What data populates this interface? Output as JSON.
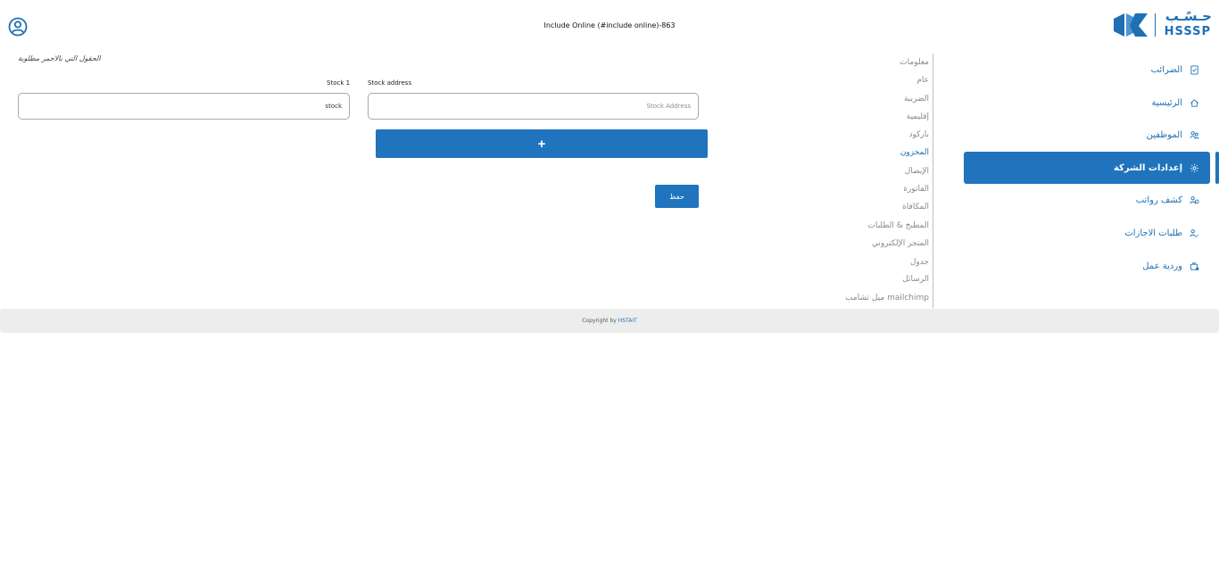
{
  "header": {
    "title": "Include Online (#include online)-863",
    "logo_ar": "حـسًـب",
    "logo_en": "HSSSP",
    "user_icon": "user-circle-icon"
  },
  "sidebar": {
    "items": [
      {
        "label": "الضرائب",
        "icon": "tax-document-icon",
        "active": false
      },
      {
        "label": "الرئيسية",
        "icon": "home-icon",
        "active": false
      },
      {
        "label": "الموظفين",
        "icon": "users-icon",
        "active": false
      },
      {
        "label": "إعدادات الشركة",
        "icon": "gear-icon",
        "active": true
      },
      {
        "label": "كشف رواتب",
        "icon": "payroll-icon",
        "active": false
      },
      {
        "label": "طلبات الاجازات",
        "icon": "leave-request-icon",
        "active": false
      },
      {
        "label": "وردية عمل",
        "icon": "shift-briefcase-icon",
        "active": false
      }
    ],
    "accent": "#1f74bd"
  },
  "subnav": {
    "items": [
      {
        "label": "معلومات"
      },
      {
        "label": "عام"
      },
      {
        "label": "الضريبة"
      },
      {
        "label": "إقليمية"
      },
      {
        "label": "باركود"
      },
      {
        "label": "المخزون",
        "current": true
      },
      {
        "label": "الإيصال"
      },
      {
        "label": "الفاتورة"
      },
      {
        "label": "المكافاة"
      },
      {
        "label": "المطبخ & الطلبات"
      },
      {
        "label": "المتجر الإلكتروني"
      },
      {
        "label": "جدول"
      },
      {
        "label": "الرسائل"
      },
      {
        "label": "mailchimp ميل تشامب"
      }
    ]
  },
  "form": {
    "required_note": "الحقول التي بالاحمر مطلوبة",
    "stock_name_label": "Stock 1",
    "stock_name_value": "stock",
    "stock_address_label": "Stock address",
    "stock_address_placeholder": "Stock Address",
    "add_button_label": "+",
    "save_button_label": "حفظ"
  },
  "footer": {
    "prefix": "Copyright by ",
    "link": "HSTAIT"
  }
}
